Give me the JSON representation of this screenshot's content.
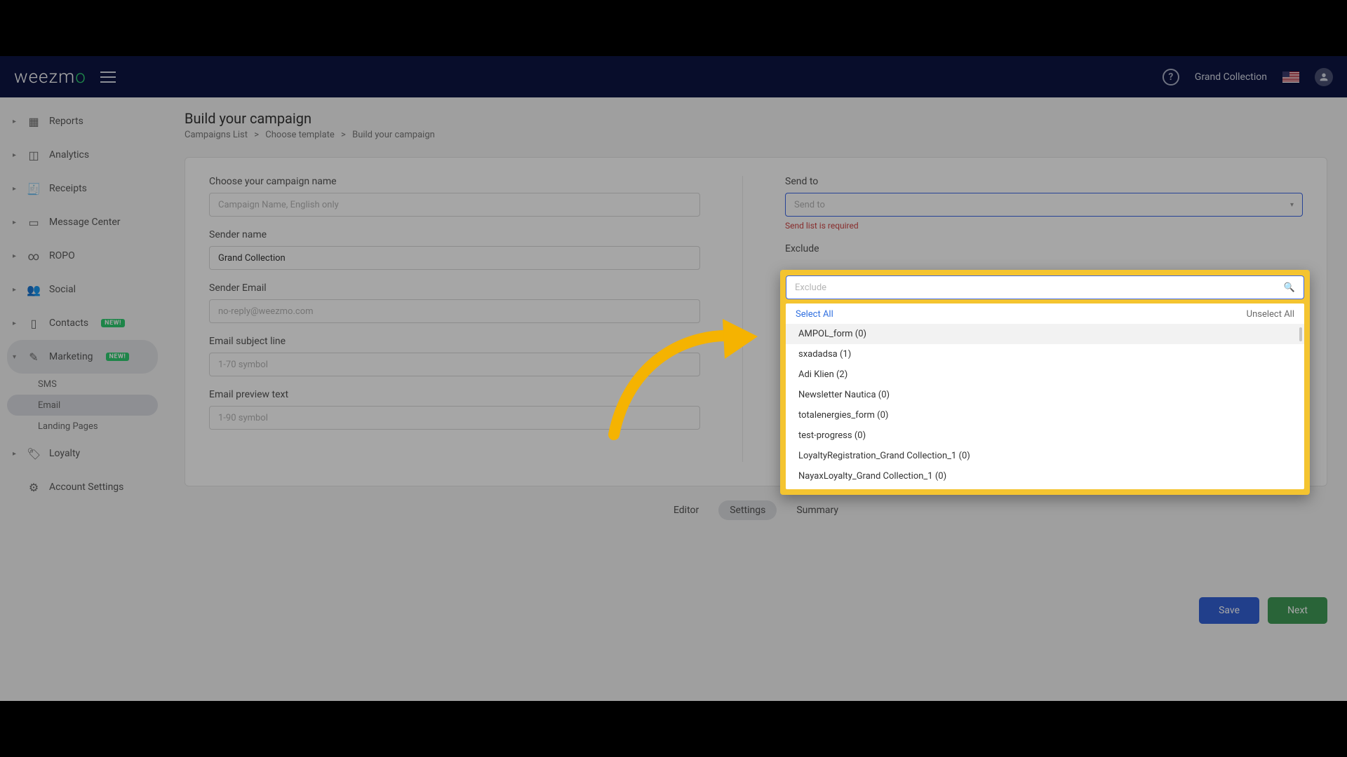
{
  "header": {
    "logo": "weezmo",
    "org": "Grand Collection"
  },
  "sidebar": {
    "reports": "Reports",
    "analytics": "Analytics",
    "receipts": "Receipts",
    "message_center": "Message Center",
    "ropo": "ROPO",
    "social": "Social",
    "contacts": "Contacts",
    "marketing": "Marketing",
    "badge_new": "NEW!",
    "sub_sms": "SMS",
    "sub_email": "Email",
    "sub_lp": "Landing Pages",
    "loyalty": "Loyalty",
    "account_settings": "Account Settings"
  },
  "page": {
    "title": "Build your campaign",
    "bc1": "Campaigns List",
    "bc2": "Choose template",
    "bc3": "Build your campaign",
    "sep": ">"
  },
  "left": {
    "name_label": "Choose your campaign name",
    "name_ph": "Campaign Name, English only",
    "sender_label": "Sender name",
    "sender_value": "Grand Collection",
    "email_label": "Sender Email",
    "email_value": "no-reply@weezmo.com",
    "subj_label": "Email subject line",
    "subj_ph": "1-70 symbol",
    "prev_label": "Email preview text",
    "prev_ph": "1-90 symbol"
  },
  "right": {
    "sendto_label": "Send to",
    "sendto_ph": "Send to",
    "sendto_err": "Send list is required",
    "exclude_label": "Exclude",
    "exclude_ph": "Exclude",
    "select_all": "Select All",
    "unselect_all": "Unselect All",
    "options": [
      "AMPOL_form (0)",
      "sxadadsa (1)",
      "Adi Klien (2)",
      "Newsletter Nautica (0)",
      "totalenergies_form (0)",
      "test-progress (0)",
      "LoyaltyRegistration_Grand Collection_1 (0)",
      "NayaxLoyalty_Grand Collection_1 (0)"
    ]
  },
  "tabs": {
    "editor": "Editor",
    "settings": "Settings",
    "summary": "Summary"
  },
  "actions": {
    "save": "Save",
    "next": "Next"
  }
}
